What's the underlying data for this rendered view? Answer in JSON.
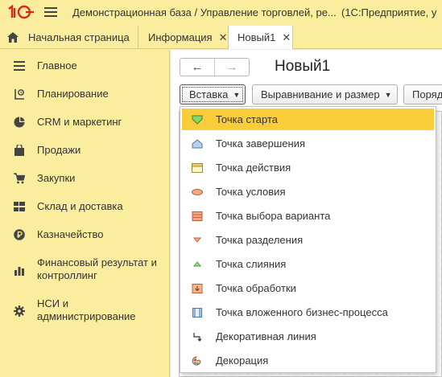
{
  "app": {
    "title": "Демонстрационная база / Управление торговлей, ре...",
    "platform": "(1С:Предприятие, у"
  },
  "tabs": [
    {
      "label": "Начальная страница"
    },
    {
      "label": "Информация"
    },
    {
      "label": "Новый1"
    }
  ],
  "sidebar": {
    "items": [
      {
        "label": "Главное",
        "icon": "list-icon"
      },
      {
        "label": "Планирование",
        "icon": "planning-icon"
      },
      {
        "label": "CRM и маркетинг",
        "icon": "pie-chart-icon"
      },
      {
        "label": "Продажи",
        "icon": "shopping-bag-icon"
      },
      {
        "label": "Закупки",
        "icon": "cart-icon"
      },
      {
        "label": "Склад и доставка",
        "icon": "warehouse-icon"
      },
      {
        "label": "Казначейство",
        "icon": "ruble-icon"
      },
      {
        "label": "Финансовый результат и контроллинг",
        "icon": "bar-chart-icon"
      },
      {
        "label": "НСИ и администрирование",
        "icon": "gear-icon"
      }
    ]
  },
  "form": {
    "title": "Новый1",
    "back": "←",
    "forward": "→"
  },
  "toolbar": {
    "insert_label": "Вставка",
    "align_label": "Выравнивание и размер",
    "order_label": "Поряд"
  },
  "menu": {
    "items": [
      {
        "label": "Точка старта",
        "icon": "start-point-icon",
        "selected": true
      },
      {
        "label": "Точка завершения",
        "icon": "end-point-icon"
      },
      {
        "label": "Точка действия",
        "icon": "action-point-icon"
      },
      {
        "label": "Точка условия",
        "icon": "condition-point-icon"
      },
      {
        "label": "Точка выбора варианта",
        "icon": "switch-point-icon"
      },
      {
        "label": "Точка разделения",
        "icon": "split-point-icon"
      },
      {
        "label": "Точка слияния",
        "icon": "merge-point-icon"
      },
      {
        "label": "Точка обработки",
        "icon": "processing-point-icon"
      },
      {
        "label": "Точка вложенного бизнес-процесса",
        "icon": "subprocess-point-icon"
      },
      {
        "label": "Декоративная линия",
        "icon": "decorative-line-icon"
      },
      {
        "label": "Декорация",
        "icon": "decoration-icon"
      }
    ]
  },
  "colors": {
    "sidebar_bg": "#fbed9e",
    "selection": "#f9cc3a",
    "brand_red": "#d7261e"
  }
}
